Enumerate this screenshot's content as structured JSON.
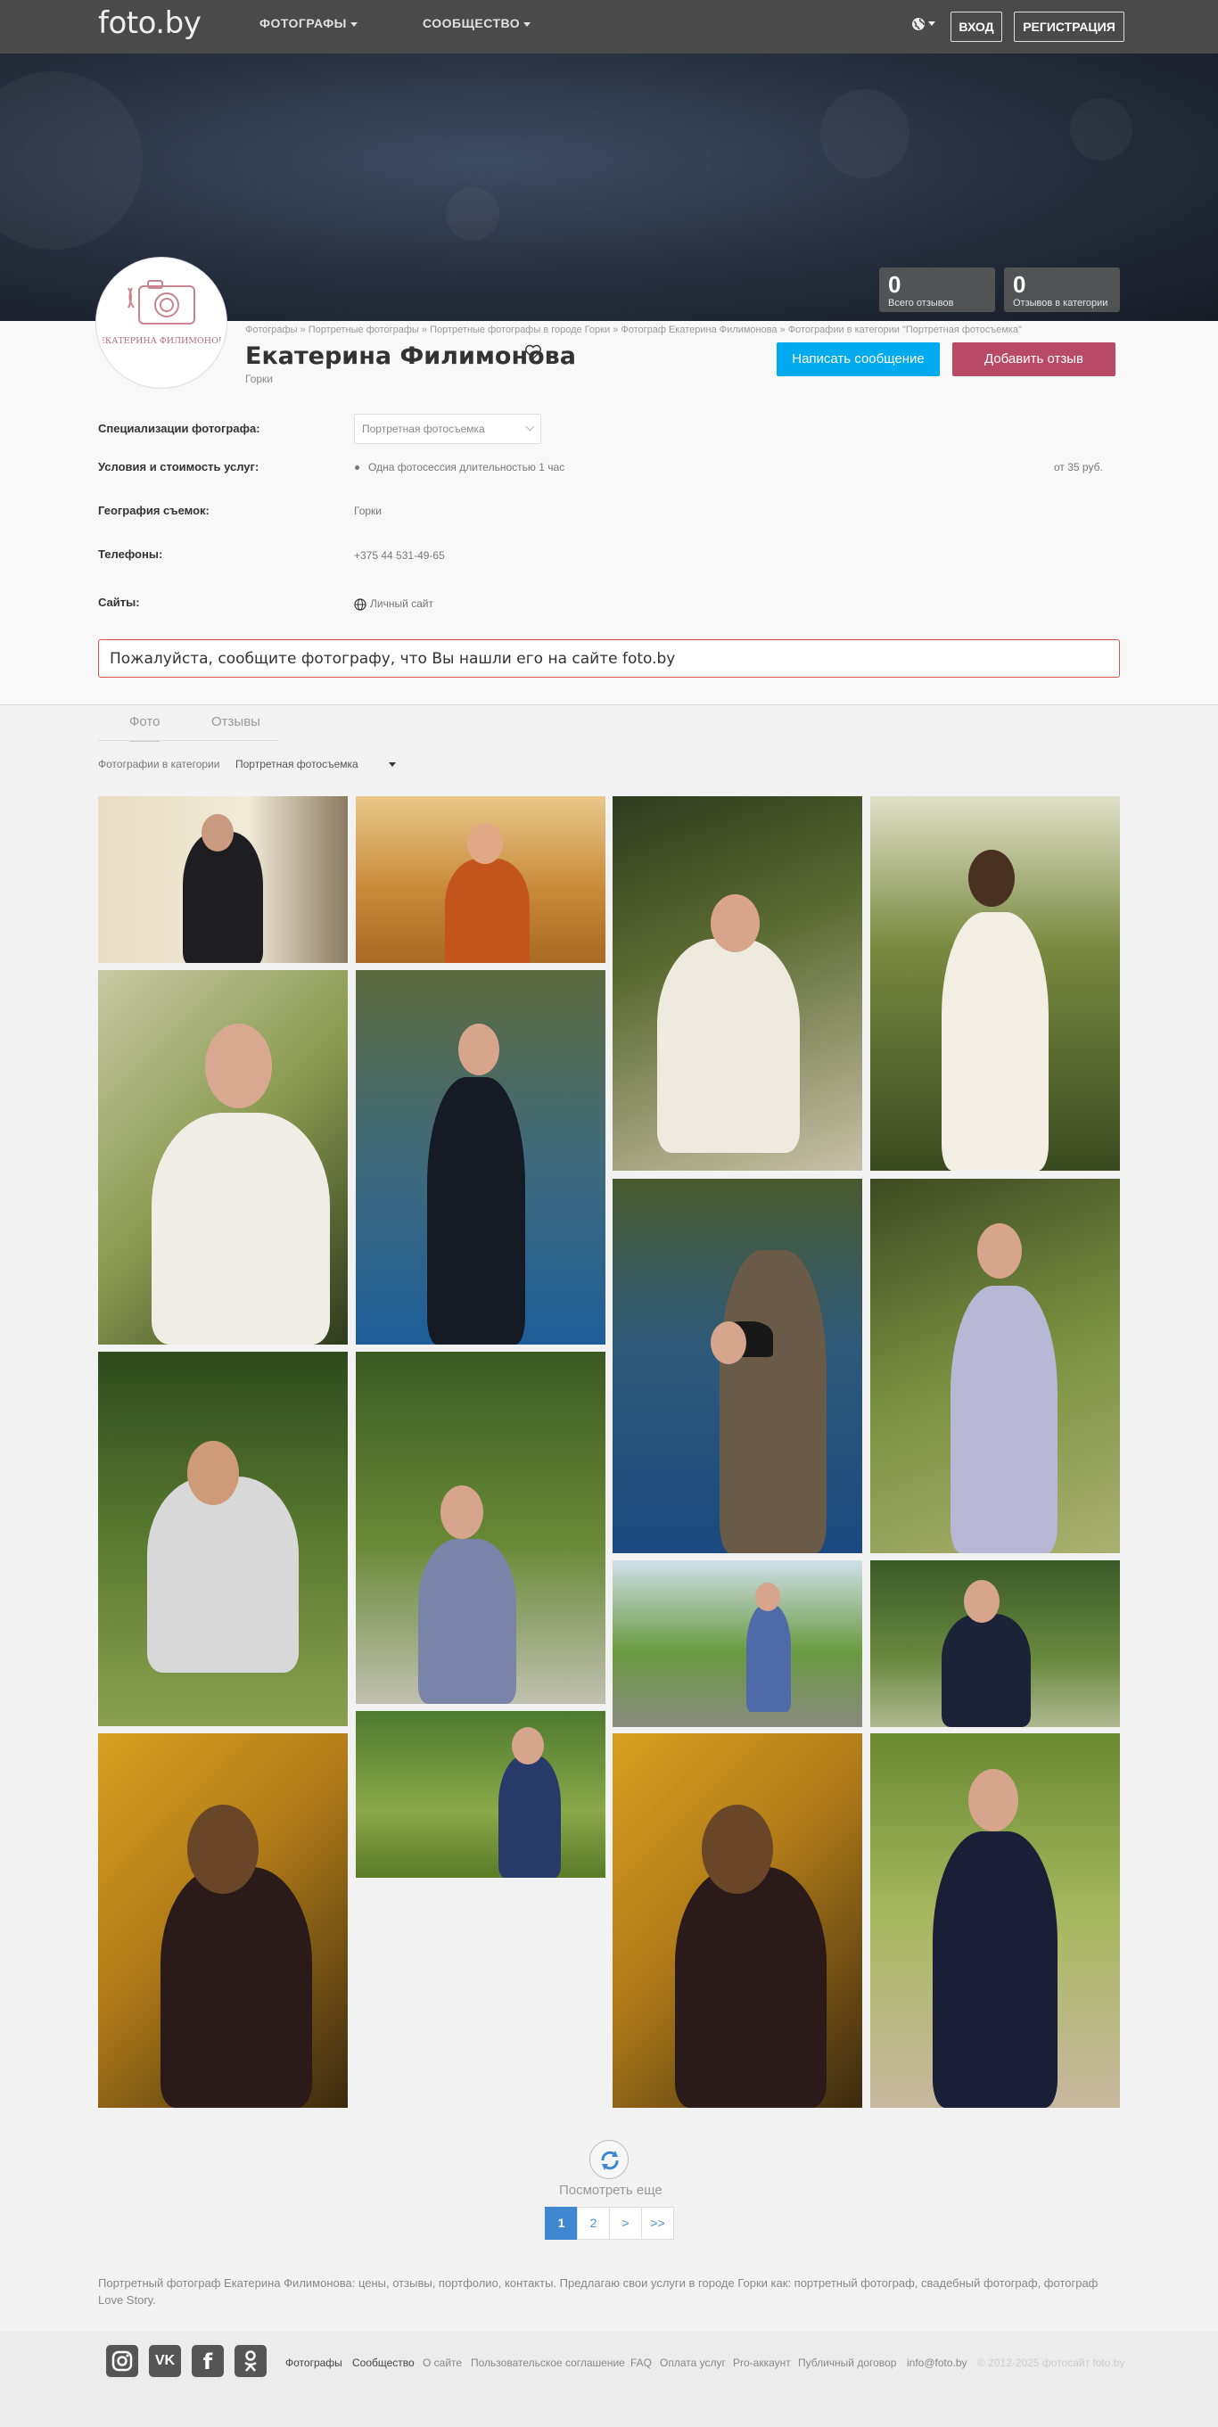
{
  "header": {
    "logo": "foto.by",
    "nav": [
      {
        "label": "ФОТОГРАФЫ"
      },
      {
        "label": "СООБЩЕСТВО"
      }
    ],
    "login": "ВХОД",
    "register": "РЕГИСТРАЦИЯ",
    "language_icon": "globe-icon"
  },
  "stats": [
    {
      "value": "0",
      "label": "Всего отзывов"
    },
    {
      "value": "0",
      "label": "Отзывов в категории"
    }
  ],
  "profile": {
    "avatar_text": "ЕКАТЕРИНА ФИЛИМОНОВА",
    "breadcrumb": "Фотографы » Портретные фотографы » Портретные фотографы в городе Горки » Фотограф Екатерина Филимонова » Фотографии в категории \"Портретная фотосъемка\"",
    "name": "Екатерина Филимонова",
    "city": "Горки",
    "message_button": "Написать сообщение",
    "review_button": "Добавить отзыв"
  },
  "info": {
    "specialization_label": "Специализации фотографа:",
    "specialization_value": "Портретная фотосъемка",
    "services_label": "Условия и стоимость услуг:",
    "service_item": "Одна фотосессия длительностью 1 час",
    "service_price": "от 35 руб.",
    "geo_label": "География съемок:",
    "geo_value": "Горки",
    "phones_label": "Телефоны:",
    "phone_value": "+375 44 531-49-65",
    "sites_label": "Сайты:",
    "site_value": "Личный сайт"
  },
  "notice": "Пожалуйста, сообщите фотографу, что Вы нашли его на сайте foto.by",
  "tabs": {
    "photo": "Фото",
    "reviews": "Отзывы"
  },
  "category": {
    "label": "Фотографии в категории",
    "value": "Портретная фотосъемка"
  },
  "gallery": {
    "more": "Посмотреть еще",
    "pages": [
      "1",
      "2",
      ">",
      ">>"
    ]
  },
  "seo_text": "Портретный фотограф Екатерина Филимонова: цены, отзывы, портфолио, контакты. Предлагаю свои услуги в городе Горки как: портретный фотограф, свадебный фотограф, фотограф Love Story.",
  "footer": {
    "social": [
      "instagram-icon",
      "vk-icon",
      "facebook-icon",
      "odnoklassniki-icon"
    ],
    "links": [
      "Фотографы",
      "Сообщество",
      "О сайте",
      "Пользовательское соглашение",
      "FAQ",
      "Оплата услуг",
      "Pro-аккаунт",
      "Публичный договор",
      "info@foto.by"
    ],
    "copyright": "© 2012-2025 фотосайт foto.by"
  },
  "colors": {
    "primary_button": "#00aaee",
    "review_button": "#b94a67",
    "active_page": "#3f87d0",
    "notice_border": "#d9534f"
  }
}
